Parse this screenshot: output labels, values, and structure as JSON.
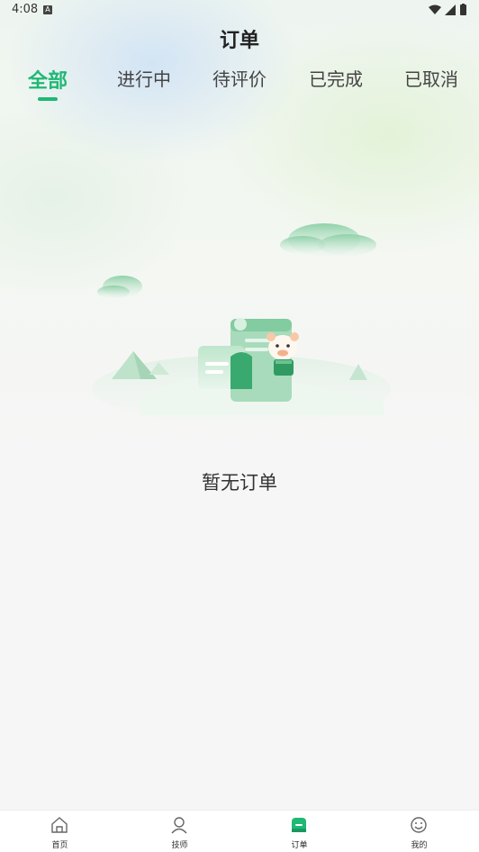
{
  "status_bar": {
    "time": "4:08",
    "notification_badge": "A"
  },
  "header": {
    "title": "订单"
  },
  "tabs": [
    {
      "label": "全部",
      "active": true
    },
    {
      "label": "进行中",
      "active": false
    },
    {
      "label": "待评价",
      "active": false
    },
    {
      "label": "已完成",
      "active": false
    },
    {
      "label": "已取消",
      "active": false
    }
  ],
  "empty_state": {
    "message": "暂无订单",
    "illustration": "empty-orders-illustration"
  },
  "bottom_nav": [
    {
      "label": "首页",
      "icon": "home-icon",
      "active": false
    },
    {
      "label": "技师",
      "icon": "technician-icon",
      "active": false
    },
    {
      "label": "订单",
      "icon": "orders-icon",
      "active": true
    },
    {
      "label": "我的",
      "icon": "profile-icon",
      "active": false
    }
  ],
  "colors": {
    "accent": "#1fb874",
    "background": "#f6f6f6",
    "text": "#222222"
  }
}
